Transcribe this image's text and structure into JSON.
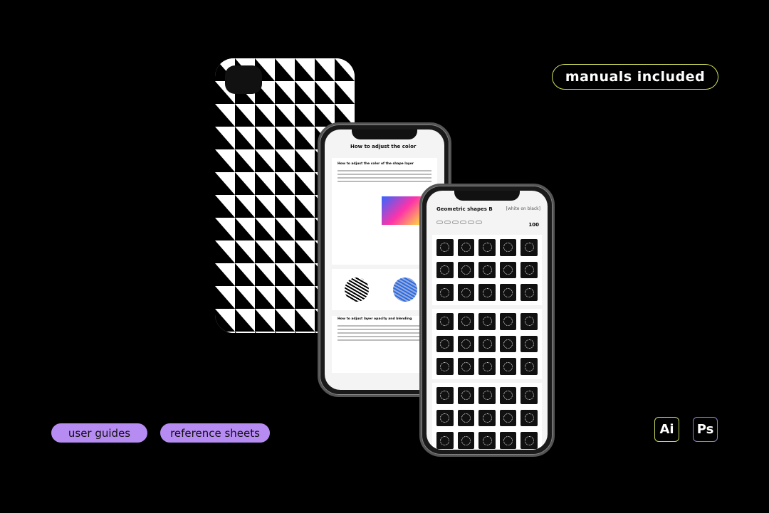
{
  "labels": {
    "manuals": "manuals included",
    "user_guides": "user guides",
    "reference_sheets": "reference sheets"
  },
  "badges": {
    "ai": "Ai",
    "ps": "Ps"
  },
  "phone1": {
    "title": "How to adjust the color",
    "section1": "How to adjust the color of the shape layer",
    "section2": "How to adjust layer opacity and blending"
  },
  "phone2": {
    "title": "Geometric shapes B",
    "subtitle": "[white on black]",
    "count": "100"
  },
  "colors": {
    "background": "#000000",
    "pill": "#b68cf2",
    "outline": "#d4e05a",
    "ps_outline": "#8f7fc8"
  }
}
